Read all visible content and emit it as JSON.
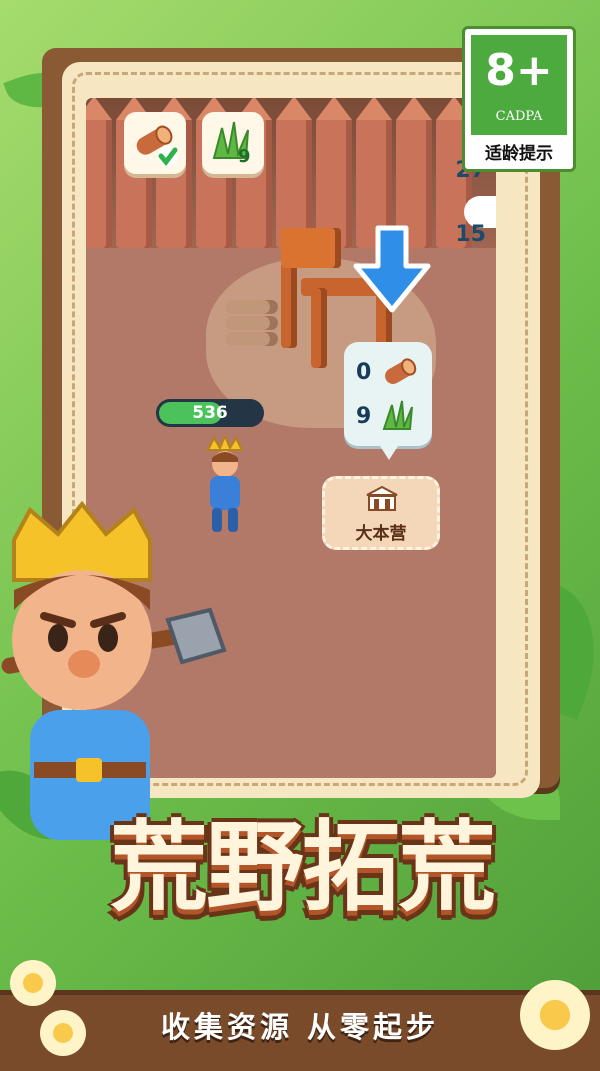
{
  "age_rating": {
    "label": "8+",
    "org": "CADPA",
    "tip": "适龄提示"
  },
  "hud": {
    "tiles": [
      {
        "icon": "wood-log-check-icon"
      },
      {
        "icon": "grass-bundle-icon",
        "count": "9"
      }
    ],
    "side_counts": [
      "27",
      "15"
    ]
  },
  "player": {
    "hp_value": "536",
    "hp_fill": 0.62
  },
  "build_requirements": {
    "wood": "0",
    "grass": "9"
  },
  "base": {
    "label": "大本营"
  },
  "title": "荒野拓荒",
  "slogan": "收集资源 从零起步",
  "colors": {
    "frame_wood": "#8a5a34",
    "hp_green": "#4cc25a",
    "arrow_blue": "#2f8fe8",
    "age_green": "#4caa3e"
  }
}
